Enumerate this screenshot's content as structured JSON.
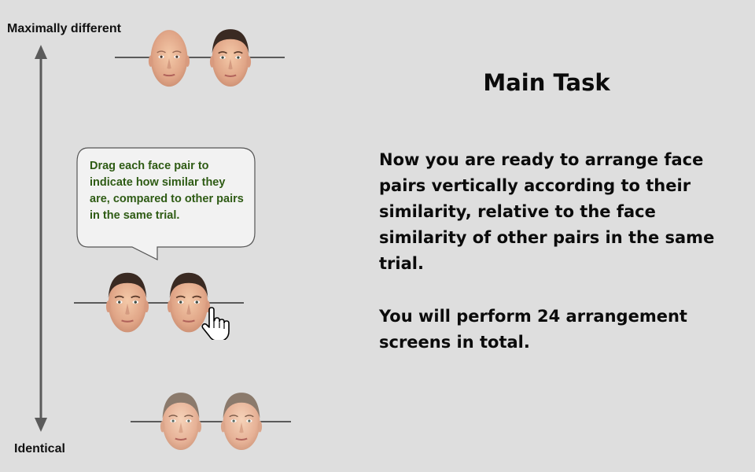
{
  "axis": {
    "top_label": "Maximally different",
    "bottom_label": "Identical"
  },
  "bubble": {
    "text": "Drag each face pair to indicate how similar they are, compared to other pairs in the same trial."
  },
  "task": {
    "title": "Main Task",
    "paragraph1": "Now you are ready to arrange face pairs vertically according to their similarity, relative to the face similarity of other pairs in the same trial.",
    "paragraph2": "You will perform 24 arrangement screens in total."
  },
  "colors": {
    "background": "#dedede",
    "bubble_text": "#2e5b14",
    "axis": "#5a5a5a"
  }
}
